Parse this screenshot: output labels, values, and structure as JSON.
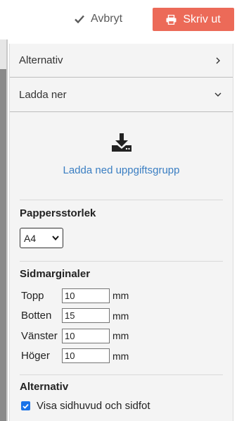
{
  "toolbar": {
    "cancel_label": "Avbryt",
    "print_label": "Skriv ut",
    "print_color": "#ec6a58"
  },
  "panel": {
    "alternativ_header": "Alternativ",
    "download_header": "Ladda ner",
    "download_link": "Ladda ned uppgiftsgrupp",
    "link_color": "#3a7ec2"
  },
  "paper": {
    "title": "Pappersstorlek",
    "selected": "A4"
  },
  "margins": {
    "title": "Sidmarginaler",
    "unit": "mm",
    "rows": [
      {
        "label": "Topp",
        "value": "10"
      },
      {
        "label": "Botten",
        "value": "15"
      },
      {
        "label": "Vänster",
        "value": "10"
      },
      {
        "label": "Höger",
        "value": "10"
      }
    ]
  },
  "options": {
    "title": "Alternativ",
    "header_footer_label": "Visa sidhuvud och sidfot",
    "header_footer_checked": true
  }
}
